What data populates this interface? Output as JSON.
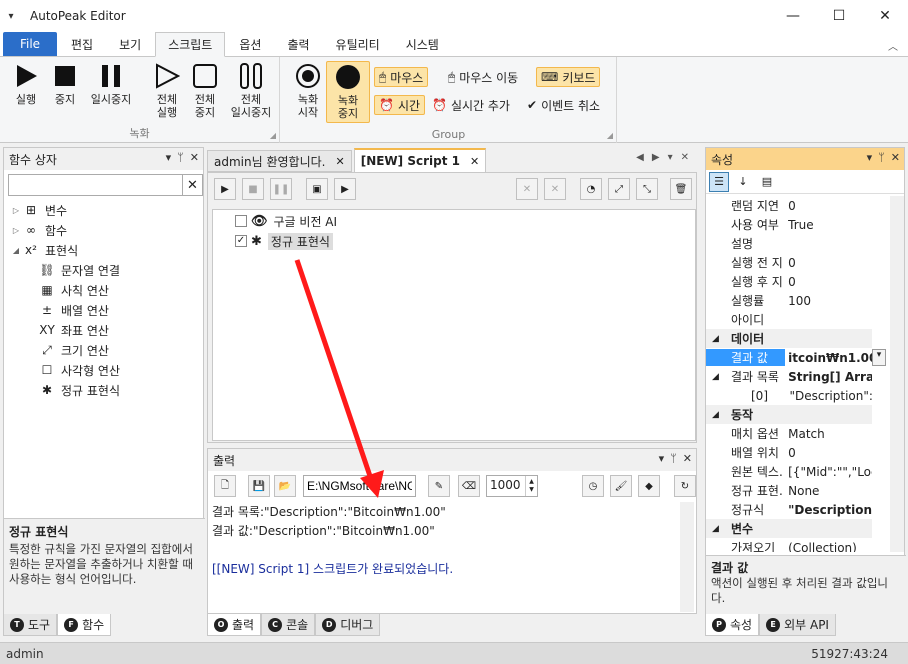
{
  "window": {
    "title": "AutoPeak Editor",
    "min_icon": "minimize-icon",
    "max_icon": "maximize-icon",
    "close_icon": "close-icon"
  },
  "ribbon_tabs": [
    "File",
    "편집",
    "보기",
    "스크립트",
    "옵션",
    "출력",
    "유틸리티",
    "시스템"
  ],
  "ribbon": {
    "run": "실행",
    "stop": "중지",
    "pause": "일시중지",
    "run_all": "전체\n실행",
    "stop_all": "전체\n중지",
    "pause_all": "전체\n일시중지",
    "rec_start": "녹화\n시작",
    "rec_stop": "녹화\n중지",
    "group_record": "녹화",
    "mouse": "마우스",
    "mouse_move": "마우스 이동",
    "keyboard": "키보드",
    "time": "시간",
    "realtime_add": "실시간 추가",
    "event_cancel": "이벤트 취소",
    "group_group": "Group"
  },
  "left_panel": {
    "title": "함수 상자",
    "search_placeholder": "",
    "tree": [
      {
        "label": "변수",
        "icon": "variable-icon",
        "level": 0,
        "expander": "▷"
      },
      {
        "label": "함수",
        "icon": "function-icon",
        "level": 0,
        "expander": "▷"
      },
      {
        "label": "표현식",
        "icon": "expression-icon",
        "level": 0,
        "expander": "◢"
      },
      {
        "label": "문자열 연결",
        "icon": "link-icon",
        "level": 1
      },
      {
        "label": "사칙 연산",
        "icon": "calculator-icon",
        "level": 1
      },
      {
        "label": "배열 연산",
        "icon": "plus-minus-icon",
        "level": 1
      },
      {
        "label": "좌표 연산",
        "icon": "xy-icon",
        "level": 1
      },
      {
        "label": "크기 연산",
        "icon": "resize-icon",
        "level": 1
      },
      {
        "label": "사각형 연산",
        "icon": "rectangle-icon",
        "level": 1
      },
      {
        "label": "정규 표현식",
        "icon": "asterisk-icon",
        "level": 1
      }
    ],
    "desc_title": "정규 표현식",
    "desc_text": "특정한 규칙을 가진 문자열의 집합에서 원하는 문자열을 추출하거나 치환할 때 사용하는 형식 언어입니다.",
    "tabs": [
      {
        "key": "T",
        "label": "도구"
      },
      {
        "key": "F",
        "label": "함수"
      }
    ]
  },
  "editor": {
    "tabs": [
      "admin님 환영합니다.",
      "[NEW] Script 1"
    ],
    "lines": [
      {
        "label": "구글 비전 AI",
        "checked": false,
        "icon": "eye-icon"
      },
      {
        "label": "정규 표현식",
        "checked": true,
        "icon": "asterisk-icon"
      }
    ]
  },
  "output_panel": {
    "title": "출력",
    "path": "E:\\NGMsoftware\\NG",
    "spin_value": "1000",
    "lines": [
      "결과 목록:\"Description\":\"Bitcoin₩n1.00\"",
      "결과 값:\"Description\":\"Bitcoin₩n1.00\""
    ],
    "done": "[[NEW] Script 1] 스크립트가 완료되었습니다.",
    "tabs": [
      {
        "key": "O",
        "label": "출력"
      },
      {
        "key": "C",
        "label": "콘솔"
      },
      {
        "key": "D",
        "label": "디버그"
      }
    ]
  },
  "props_panel": {
    "title": "속성",
    "rows": [
      {
        "name": "랜덤 지연",
        "value": "0"
      },
      {
        "name": "사용 여부",
        "value": "True"
      },
      {
        "name": "설명",
        "value": ""
      },
      {
        "name": "실행 전 지",
        "value": "0"
      },
      {
        "name": "실행 후 지",
        "value": "0"
      },
      {
        "name": "실행률",
        "value": "100"
      },
      {
        "name": "아이디",
        "value": ""
      },
      {
        "name": "데이터",
        "value": "",
        "cat": true
      },
      {
        "name": "결과 값",
        "value": "itcoin₩n1.00\"",
        "sel": true
      },
      {
        "name": "결과 목록",
        "value": "String[] Array",
        "expander": "◢"
      },
      {
        "name": "[0]",
        "value": "\"Description\":\"Bitc"
      },
      {
        "name": "동작",
        "value": "",
        "cat": true
      },
      {
        "name": "매치 옵션",
        "value": "Match"
      },
      {
        "name": "배열 위치",
        "value": "0"
      },
      {
        "name": "원본 텍스.",
        "value": "[{\"Mid\":\"\",\"Local"
      },
      {
        "name": "정규 표현.",
        "value": "None"
      },
      {
        "name": "정규식",
        "value": "\"Description\":\"(["
      },
      {
        "name": "변수",
        "value": "",
        "cat": true
      },
      {
        "name": "가져오기",
        "value": "(Collection)"
      }
    ],
    "desc_title": "결과 값",
    "desc_text": "액션이 실행된 후 처리된 결과 값입니다.",
    "tabs": [
      {
        "key": "P",
        "label": "속성"
      },
      {
        "key": "E",
        "label": "외부 API"
      }
    ]
  },
  "status": {
    "user": "admin",
    "time": "51927:43:24"
  },
  "colors": {
    "accent": "#2b6ec9",
    "highlight": "#fce4a8",
    "arrow": "#ff1a1a",
    "done_text": "#1a2e9c"
  }
}
